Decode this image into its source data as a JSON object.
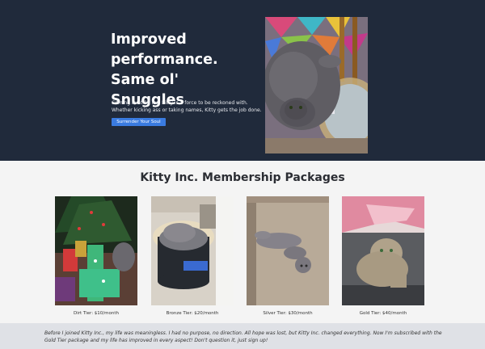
{
  "hero": {
    "title": "Improved performance. Same ol' Snuggles",
    "body": "Coming in at 16 lbs, Kitty is a force to be reckoned with. Whether kicking ass or taking names, Kitty gets the job done.",
    "cta_label": "Surrender Your Soul"
  },
  "packages": {
    "title": "Kitty Inc. Membership Packages",
    "tiers": [
      {
        "label": "Dirt Tier: $10/month"
      },
      {
        "label": "Bronze Tier: $20/month"
      },
      {
        "label": "Silver Tier: $30/month"
      },
      {
        "label": "Gold Tier: $40/month"
      }
    ]
  },
  "testimonial": {
    "text": "Before I joined Kitty Inc., my life was meaningless. I had no purpose, no direction. All hope was lost, but Kitty Inc. changed everything. Now I'm subscribed with the Gold Tier package and my life has improved in every aspect! Don't question it, just sign up!"
  },
  "colors": {
    "hero_bg": "#202a3b",
    "cta": "#3a7be0",
    "page_bg": "#f4f4f4",
    "testimonial_bg": "#dfe1e6"
  }
}
